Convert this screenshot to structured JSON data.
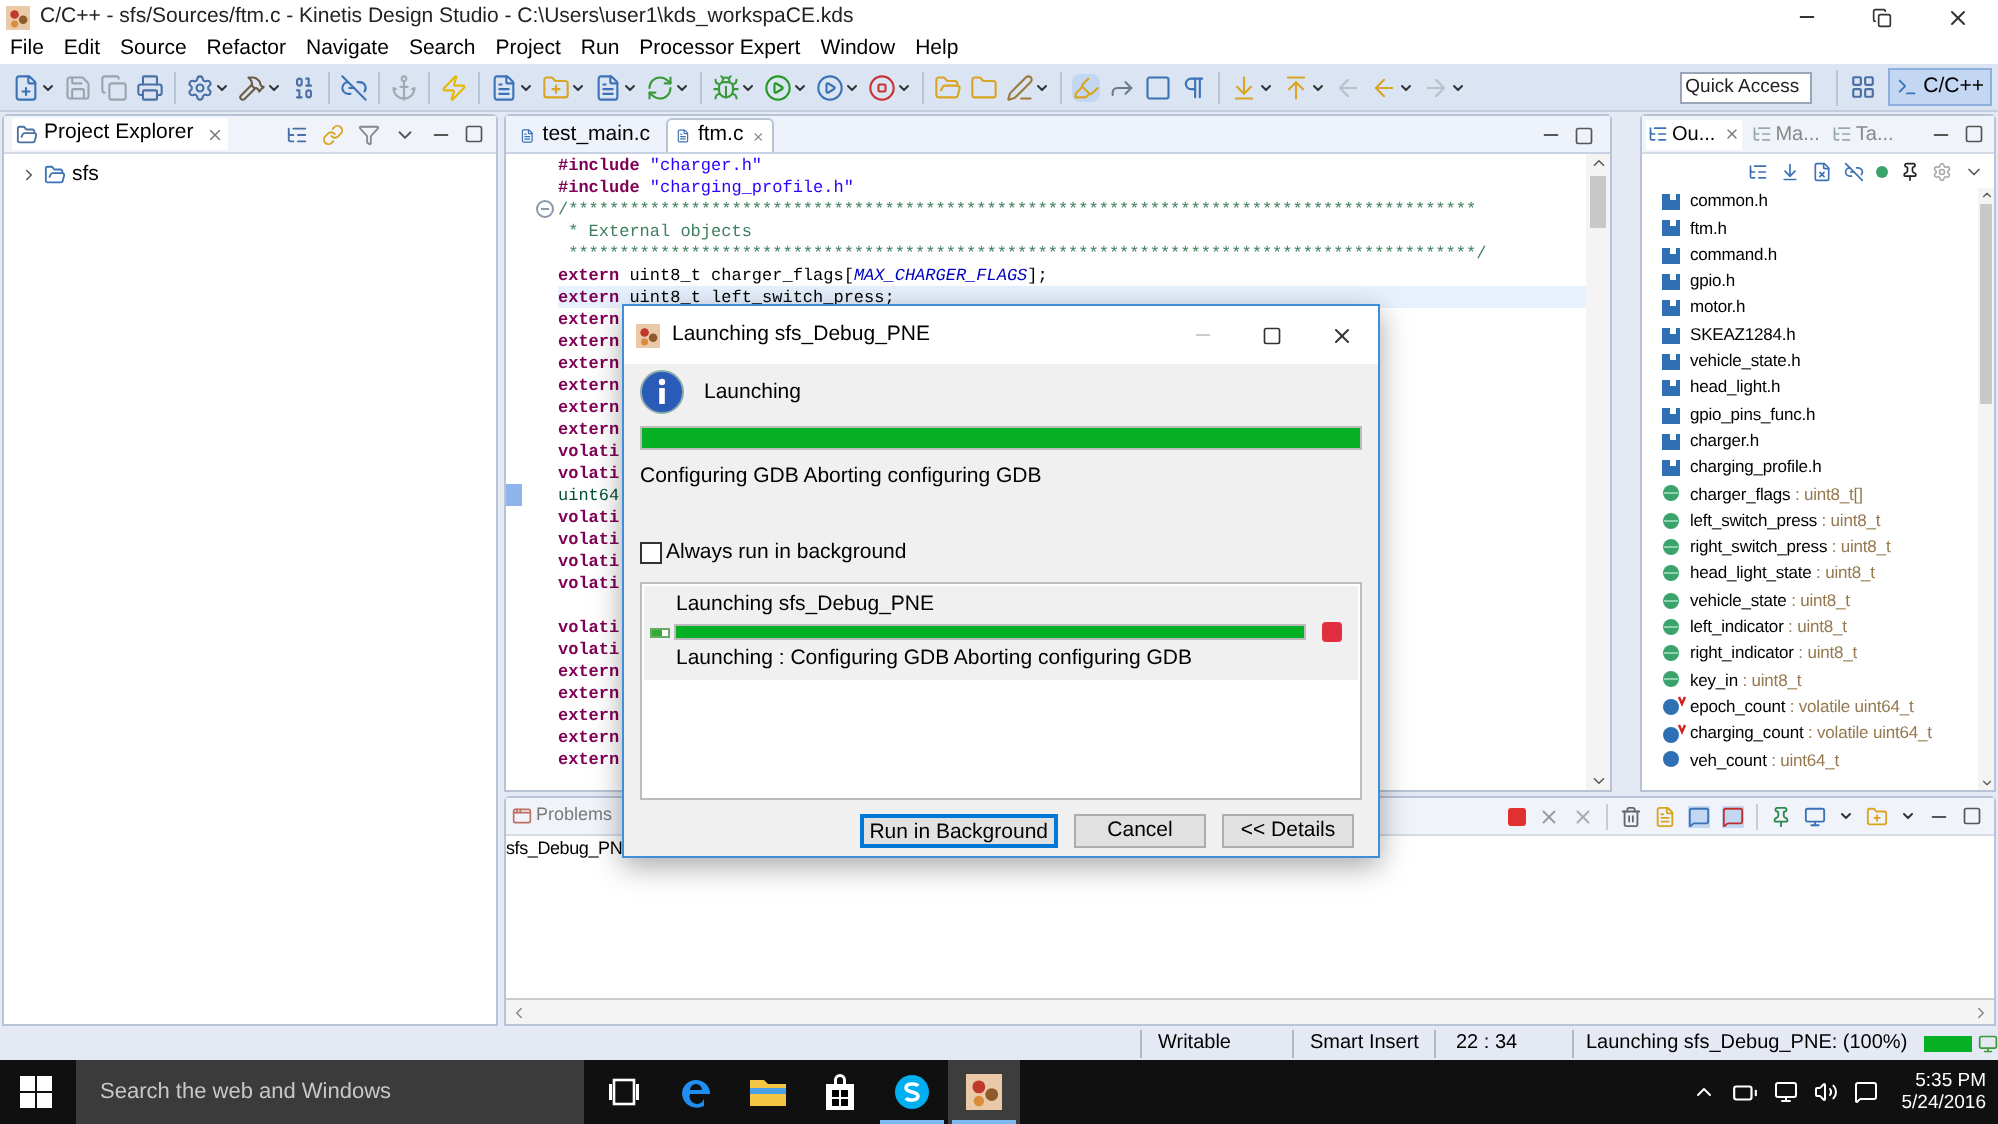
{
  "window": {
    "title": "C/C++ - sfs/Sources/ftm.c - Kinetis Design Studio - C:\\Users\\user1\\kds_workspaCE.kds"
  },
  "menu": [
    "File",
    "Edit",
    "Source",
    "Refactor",
    "Navigate",
    "Search",
    "Project",
    "Run",
    "Processor Expert",
    "Window",
    "Help"
  ],
  "toolbar": {
    "quick_access": {
      "placeholder": "Quick Access"
    },
    "perspective": {
      "label": "C/C++",
      "selected": true
    }
  },
  "project_explorer": {
    "tab": {
      "label": "Project Explorer"
    },
    "tree": [
      {
        "label": "sfs",
        "expanded": false
      }
    ]
  },
  "editor": {
    "tabs": [
      {
        "label": "test_main.c",
        "selected": false
      },
      {
        "label": "ftm.c",
        "selected": true
      }
    ],
    "lines": [
      {
        "kind": "code",
        "current": false,
        "marker": false,
        "foldable": false,
        "segments": [
          {
            "kind": "keyword",
            "text": "#include"
          },
          {
            "kind": "string",
            "text": " \"charger.h\""
          }
        ]
      },
      {
        "kind": "code",
        "current": false,
        "marker": false,
        "foldable": false,
        "segments": [
          {
            "kind": "keyword",
            "text": "#include"
          },
          {
            "kind": "string",
            "text": " \"charging_profile.h\""
          }
        ]
      },
      {
        "kind": "code",
        "current": false,
        "marker": false,
        "foldable": true,
        "segments": [
          {
            "kind": "comment",
            "text": "/*****************************************************************************************"
          }
        ]
      },
      {
        "kind": "code",
        "current": false,
        "marker": false,
        "foldable": false,
        "segments": [
          {
            "kind": "comment",
            "text": " * External objects"
          }
        ]
      },
      {
        "kind": "code",
        "current": false,
        "marker": false,
        "foldable": false,
        "segments": [
          {
            "kind": "comment",
            "text": " *****************************************************************************************/"
          }
        ]
      },
      {
        "kind": "code",
        "current": false,
        "marker": false,
        "foldable": false,
        "segments": [
          {
            "kind": "keyword",
            "text": "extern"
          },
          {
            "kind": "plain",
            "text": " uint8_t charger_flags["
          },
          {
            "kind": "macro",
            "text": "MAX_CHARGER_FLAGS"
          },
          {
            "kind": "plain",
            "text": "];"
          }
        ]
      },
      {
        "kind": "code",
        "current": true,
        "marker": false,
        "foldable": false,
        "segments": [
          {
            "kind": "keyword",
            "text": "extern"
          },
          {
            "kind": "plain",
            "text": " uint8_t left_switch_press;"
          }
        ]
      },
      {
        "kind": "code",
        "current": false,
        "marker": false,
        "foldable": false,
        "segments": [
          {
            "kind": "keyword",
            "text": "extern"
          }
        ]
      },
      {
        "kind": "code",
        "current": false,
        "marker": false,
        "foldable": false,
        "segments": [
          {
            "kind": "keyword",
            "text": "extern"
          }
        ]
      },
      {
        "kind": "code",
        "current": false,
        "marker": false,
        "foldable": false,
        "segments": [
          {
            "kind": "keyword",
            "text": "extern"
          }
        ]
      },
      {
        "kind": "code",
        "current": false,
        "marker": false,
        "foldable": false,
        "segments": [
          {
            "kind": "keyword",
            "text": "extern"
          }
        ]
      },
      {
        "kind": "code",
        "current": false,
        "marker": false,
        "foldable": false,
        "segments": [
          {
            "kind": "keyword",
            "text": "extern"
          }
        ]
      },
      {
        "kind": "code",
        "current": false,
        "marker": false,
        "foldable": false,
        "segments": [
          {
            "kind": "keyword",
            "text": "extern"
          }
        ]
      },
      {
        "kind": "code",
        "current": false,
        "marker": false,
        "foldable": false,
        "segments": [
          {
            "kind": "keyword",
            "text": "volati"
          }
        ]
      },
      {
        "kind": "code",
        "current": false,
        "marker": false,
        "foldable": false,
        "segments": [
          {
            "kind": "keyword",
            "text": "volati"
          }
        ]
      },
      {
        "kind": "code",
        "current": false,
        "marker": true,
        "foldable": false,
        "segments": [
          {
            "kind": "type",
            "text": "uint64"
          }
        ]
      },
      {
        "kind": "code",
        "current": false,
        "marker": false,
        "foldable": false,
        "segments": [
          {
            "kind": "keyword",
            "text": "volati"
          }
        ]
      },
      {
        "kind": "code",
        "current": false,
        "marker": false,
        "foldable": false,
        "segments": [
          {
            "kind": "keyword",
            "text": "volati"
          }
        ]
      },
      {
        "kind": "code",
        "current": false,
        "marker": false,
        "foldable": false,
        "segments": [
          {
            "kind": "keyword",
            "text": "volati"
          }
        ]
      },
      {
        "kind": "code",
        "current": false,
        "marker": false,
        "foldable": false,
        "segments": [
          {
            "kind": "keyword",
            "text": "volati"
          }
        ]
      },
      {
        "kind": "blank",
        "current": false,
        "marker": false,
        "foldable": false
      },
      {
        "kind": "code",
        "current": false,
        "marker": false,
        "foldable": false,
        "segments": [
          {
            "kind": "keyword",
            "text": "volati"
          }
        ]
      },
      {
        "kind": "code",
        "current": false,
        "marker": false,
        "foldable": false,
        "segments": [
          {
            "kind": "keyword",
            "text": "volati"
          }
        ]
      },
      {
        "kind": "code",
        "current": false,
        "marker": false,
        "foldable": false,
        "segments": [
          {
            "kind": "keyword",
            "text": "extern"
          }
        ]
      },
      {
        "kind": "code",
        "current": false,
        "marker": false,
        "foldable": false,
        "segments": [
          {
            "kind": "keyword",
            "text": "extern"
          }
        ]
      },
      {
        "kind": "code",
        "current": false,
        "marker": false,
        "foldable": false,
        "segments": [
          {
            "kind": "keyword",
            "text": "extern"
          }
        ]
      },
      {
        "kind": "code",
        "current": false,
        "marker": false,
        "foldable": false,
        "segments": [
          {
            "kind": "keyword",
            "text": "extern"
          }
        ]
      },
      {
        "kind": "code",
        "current": false,
        "marker": false,
        "foldable": false,
        "segments": [
          {
            "kind": "keyword",
            "text": "extern"
          }
        ]
      }
    ]
  },
  "outline": {
    "tabs": [
      {
        "label": "Ou...",
        "selected": true
      },
      {
        "label": "Ma...",
        "selected": false
      },
      {
        "label": "Ta...",
        "selected": false
      }
    ],
    "items": [
      {
        "kind": "include",
        "name": "common.h"
      },
      {
        "kind": "include",
        "name": "ftm.h"
      },
      {
        "kind": "include",
        "name": "command.h"
      },
      {
        "kind": "include",
        "name": "gpio.h"
      },
      {
        "kind": "include",
        "name": "motor.h"
      },
      {
        "kind": "include",
        "name": "SKEAZ1284.h"
      },
      {
        "kind": "include",
        "name": "vehicle_state.h"
      },
      {
        "kind": "include",
        "name": "head_light.h"
      },
      {
        "kind": "include",
        "name": "gpio_pins_func.h"
      },
      {
        "kind": "include",
        "name": "charger.h"
      },
      {
        "kind": "include",
        "name": "charging_profile.h"
      },
      {
        "kind": "variable",
        "name": "charger_flags",
        "type": " : uint8_t[]"
      },
      {
        "kind": "variable",
        "name": "left_switch_press",
        "type": " : uint8_t"
      },
      {
        "kind": "variable",
        "name": "right_switch_press",
        "type": " : uint8_t"
      },
      {
        "kind": "variable",
        "name": "head_light_state",
        "type": " : uint8_t"
      },
      {
        "kind": "variable",
        "name": "vehicle_state",
        "type": " : uint8_t"
      },
      {
        "kind": "variable",
        "name": "left_indicator",
        "type": " : uint8_t"
      },
      {
        "kind": "variable",
        "name": "right_indicator",
        "type": " : uint8_t"
      },
      {
        "kind": "variable",
        "name": "key_in",
        "type": " : uint8_t"
      },
      {
        "kind": "volatile",
        "name": "epoch_count",
        "type": " : volatile uint64_t"
      },
      {
        "kind": "volatile",
        "name": "charging_count",
        "type": " : volatile uint64_t"
      },
      {
        "kind": "plain_var",
        "name": "veh_count",
        "type": " : uint64_t"
      }
    ]
  },
  "console": {
    "tab": {
      "label": "Problems"
    },
    "lines": [
      "sfs_Debug_PN"
    ]
  },
  "status_bar": {
    "writable": "Writable",
    "insert_mode": "Smart Insert",
    "position": "22 : 34",
    "job": "Launching sfs_Debug_PNE: (100%)",
    "level": 1
  },
  "dialog": {
    "title": "Launching sfs_Debug_PNE",
    "heading": "Launching",
    "level": 1,
    "message": "Configuring GDB Aborting configuring GDB",
    "always_background": {
      "label": "Always run in background",
      "checked": false
    },
    "jobs": [
      {
        "name": "Launching sfs_Debug_PNE",
        "level": 1,
        "detail": "Launching : Configuring GDB Aborting configuring GDB"
      }
    ],
    "buttons": [
      {
        "label": "Run in Background",
        "default": true
      },
      {
        "label": "Cancel",
        "default": false
      },
      {
        "label": "<< Details",
        "default": false
      }
    ]
  },
  "taskbar": {
    "search": {
      "placeholder": "Search the web and Windows"
    },
    "apps": [
      {
        "kind": "task_view",
        "running": false,
        "selected": false
      },
      {
        "kind": "edge",
        "running": false,
        "selected": false
      },
      {
        "kind": "explorer",
        "running": false,
        "selected": false
      },
      {
        "kind": "store",
        "running": false,
        "selected": false
      },
      {
        "kind": "skype",
        "running": true,
        "selected": false
      },
      {
        "kind": "kds",
        "running": true,
        "selected": true
      }
    ],
    "time": "5:35 PM",
    "date": "5/24/2016"
  }
}
